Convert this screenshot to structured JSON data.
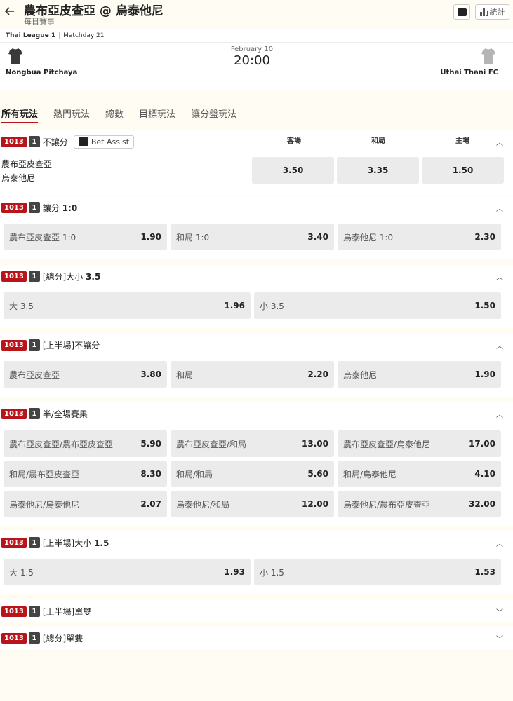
{
  "header": {
    "title": "農布亞皮查亞 @ 烏泰他尼",
    "subtitle": "每日賽事",
    "stats_label": "統計"
  },
  "match": {
    "league": "Thai League 1",
    "matchday": "Matchday 21",
    "date": "February 10",
    "time": "20:00",
    "home_team": "Nongbua Pitchaya",
    "away_team": "Uthai Thani FC",
    "home_shirt_color": "#3a3a3a",
    "away_shirt_color": "#b5b5b5"
  },
  "tabs": [
    "所有玩法",
    "熱門玩法",
    "總數",
    "目標玩法",
    "讓分盤玩法"
  ],
  "colors": {
    "accent": "#b8141a",
    "cell_bg": "#ebebeb"
  },
  "markets": {
    "m1": {
      "code": "1013",
      "num": "1",
      "name": "不讓分",
      "bet_assist": "Bet Assist",
      "cols": [
        "客場",
        "和局",
        "主場"
      ],
      "team1": "農布亞皮查亞",
      "team2": "烏泰他尼",
      "odds": [
        "3.50",
        "3.35",
        "1.50"
      ]
    },
    "m2": {
      "code": "1013",
      "num": "1",
      "name": "讓分 ",
      "name_bold": "1:0",
      "cells": [
        {
          "label": "農布亞皮查亞 1:0",
          "odds": "1.90"
        },
        {
          "label": "和局 1:0",
          "odds": "3.40"
        },
        {
          "label": "烏泰他尼 1:0",
          "odds": "2.30"
        }
      ]
    },
    "m3": {
      "code": "1013",
      "num": "1",
      "name": "[總分]大小 ",
      "name_bold": "3.5",
      "cells": [
        {
          "label": "大 3.5",
          "odds": "1.96"
        },
        {
          "label": "小 3.5",
          "odds": "1.50"
        }
      ]
    },
    "m4": {
      "code": "1013",
      "num": "1",
      "name": "[上半場]不讓分",
      "cells": [
        {
          "label": "農布亞皮查亞",
          "odds": "3.80"
        },
        {
          "label": "和局",
          "odds": "2.20"
        },
        {
          "label": "烏泰他尼",
          "odds": "1.90"
        }
      ]
    },
    "m5": {
      "code": "1013",
      "num": "1",
      "name": "半/全場賽果",
      "cells": [
        {
          "label": "農布亞皮查亞/農布亞皮查亞",
          "odds": "5.90"
        },
        {
          "label": "農布亞皮查亞/和局",
          "odds": "13.00"
        },
        {
          "label": "農布亞皮查亞/烏泰他尼",
          "odds": "17.00"
        },
        {
          "label": "和局/農布亞皮查亞",
          "odds": "8.30"
        },
        {
          "label": "和局/和局",
          "odds": "5.60"
        },
        {
          "label": "和局/烏泰他尼",
          "odds": "4.10"
        },
        {
          "label": "烏泰他尼/烏泰他尼",
          "odds": "2.07"
        },
        {
          "label": "烏泰他尼/和局",
          "odds": "12.00"
        },
        {
          "label": "烏泰他尼/農布亞皮查亞",
          "odds": "32.00"
        }
      ]
    },
    "m6": {
      "code": "1013",
      "num": "1",
      "name": "[上半場]大小 ",
      "name_bold": "1.5",
      "cells": [
        {
          "label": "大 1.5",
          "odds": "1.93"
        },
        {
          "label": "小 1.5",
          "odds": "1.53"
        }
      ]
    },
    "m7": {
      "code": "1013",
      "num": "1",
      "name": "[上半場]單雙"
    },
    "m8": {
      "code": "1013",
      "num": "1",
      "name": "[總分]單雙"
    }
  }
}
